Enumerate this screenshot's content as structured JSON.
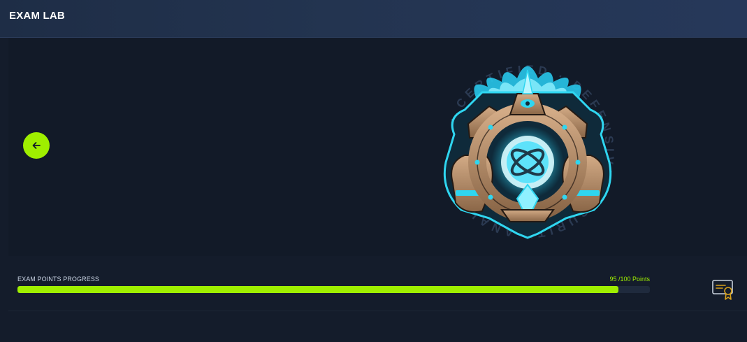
{
  "header": {
    "title": "EXAM LAB"
  },
  "hero": {
    "badge_ring_text": "· CERTIFIED · DEFENSIVE SECURITY ANALYST · HACKTHEBOX"
  },
  "progress": {
    "label": "EXAM POINTS PROGRESS",
    "value_text": "95 /100 Points",
    "current": 95,
    "max": 100
  },
  "colors": {
    "accent": "#9fef00",
    "header_bg": "#233450",
    "page_bg": "#141c2b",
    "badge_cyan": "#2fd6f0",
    "badge_bronze": "#b08a68",
    "cert_icon": "#d9a21b"
  },
  "icons": {
    "back": "arrow-left-icon",
    "certificate": "certificate-icon"
  }
}
